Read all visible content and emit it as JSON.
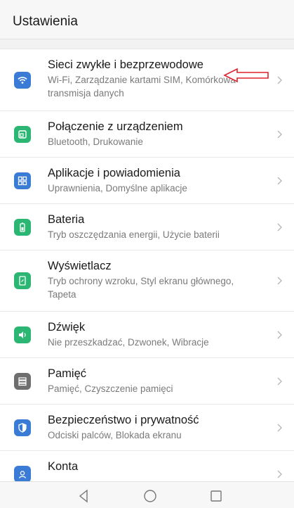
{
  "header": {
    "title": "Ustawienia"
  },
  "settings": [
    {
      "label": "Sieci zwykłe i bezprzewodowe",
      "subtitle": "Wi-Fi, Zarządzanie kartami SIM, Komórkowa transmisja danych",
      "icon": "wifi-icon",
      "color": "#3a7bd5"
    },
    {
      "label": "Połączenie z urządzeniem",
      "subtitle": "Bluetooth, Drukowanie",
      "icon": "device-connection-icon",
      "color": "#2bb673"
    },
    {
      "label": "Aplikacje i powiadomienia",
      "subtitle": "Uprawnienia, Domyślne aplikacje",
      "icon": "apps-grid-icon",
      "color": "#3a7bd5"
    },
    {
      "label": "Bateria",
      "subtitle": "Tryb oszczędzania energii, Użycie baterii",
      "icon": "battery-icon",
      "color": "#2bb673"
    },
    {
      "label": "Wyświetlacz",
      "subtitle": "Tryb ochrony wzroku, Styl ekranu głównego, Tapeta",
      "icon": "display-icon",
      "color": "#2bb673"
    },
    {
      "label": "Dźwięk",
      "subtitle": "Nie przeszkadzać, Dzwonek, Wibracje",
      "icon": "speaker-icon",
      "color": "#2bb673"
    },
    {
      "label": "Pamięć",
      "subtitle": "Pamięć, Czyszczenie pamięci",
      "icon": "storage-icon",
      "color": "#6e6e6e"
    },
    {
      "label": "Bezpieczeństwo i prywatność",
      "subtitle": "Odciski palców, Blokada ekranu",
      "icon": "shield-icon",
      "color": "#3a7bd5"
    },
    {
      "label": "Konta",
      "subtitle": "",
      "icon": "account-icon",
      "color": "#3a7bd5"
    }
  ],
  "annotation": {
    "arrow_color": "#e0202a"
  },
  "navbar": {
    "back": "back-icon",
    "home": "home-icon",
    "recents": "recents-icon"
  }
}
